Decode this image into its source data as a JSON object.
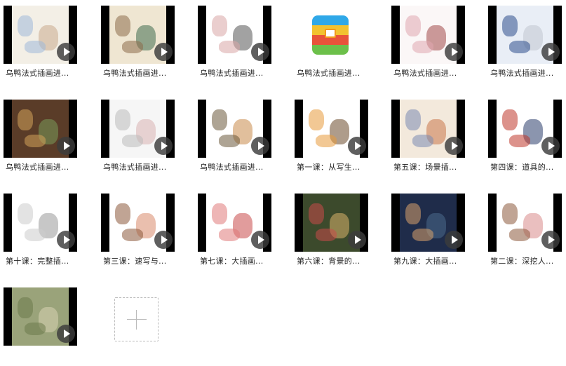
{
  "files": [
    {
      "label": "乌鸭法式插画进...",
      "art": [
        "#f3efe6",
        "#9fb8d8",
        "#c9a98c"
      ],
      "caption": ""
    },
    {
      "label": "乌鸭法式插画进...",
      "art": [
        "#efe6d2",
        "#8c6b4a",
        "#3f6b4e"
      ],
      "caption": ""
    },
    {
      "label": "乌鸭法式插画进...",
      "art": [
        "#ffffff",
        "#d9a6a6",
        "#555555"
      ],
      "caption": ""
    },
    {
      "label": "乌鸭法式插画进...",
      "art": [],
      "caption": "",
      "app_icon": true
    },
    {
      "label": "乌鸭法式插画进...",
      "art": [
        "#fbf7f7",
        "#e0a8b0",
        "#a24a4a"
      ],
      "caption": ""
    },
    {
      "label": "乌鸭法式插画进...",
      "art": [
        "#e9eef6",
        "#2d4f8c",
        "#c1c7d0"
      ],
      "caption": ""
    },
    {
      "label": "乌鸭法式插画进...",
      "art": [
        "#5a3c28",
        "#d4a35a",
        "#7a9a5a"
      ],
      "caption": ""
    },
    {
      "label": "乌鸭法式插画进...",
      "art": [
        "#f6f6f6",
        "#bbbbbb",
        "#d9b3b3"
      ],
      "caption": ""
    },
    {
      "label": "乌鸭法式插画进...",
      "art": [
        "#ffffff",
        "#6b5a3c",
        "#c98a4a"
      ],
      "caption": ""
    },
    {
      "label": "第一课：从写生...",
      "art": [
        "#ffffff",
        "#e79a3c",
        "#6b4a2c"
      ],
      "caption": ""
    },
    {
      "label": "第五课：场景插...",
      "art": [
        "#f3e9dc",
        "#7a8ab3",
        "#c9764a"
      ],
      "caption": ""
    },
    {
      "label": "第四课：道具的...",
      "art": [
        "#ffffff",
        "#c0392b",
        "#2c3e6b"
      ],
      "caption": ""
    },
    {
      "label": "第十课：完整插...",
      "art": [
        "#ffffff",
        "#cccccc",
        "#999999"
      ],
      "caption": ""
    },
    {
      "label": "第三课：速写与...",
      "art": [
        "#ffffff",
        "#8c5a3c",
        "#d98a6b"
      ],
      "caption": ""
    },
    {
      "label": "第七课：大插画...",
      "art": [
        "#ffffff",
        "#e07a7a",
        "#c94a4a"
      ],
      "caption": ""
    },
    {
      "label": "第六课：背景的...",
      "art": [
        "#3c4a2c",
        "#c94a4a",
        "#d9b36b"
      ],
      "caption": ""
    },
    {
      "label": "第九课：大插画...",
      "art": [
        "#1f2c4a",
        "#d9a36b",
        "#4a6b8c"
      ],
      "caption": ""
    },
    {
      "label": "第二课：深挖人...",
      "art": [
        "#ffffff",
        "#8c5a3c",
        "#d98a8a"
      ],
      "caption": ""
    },
    {
      "label": "",
      "art": [
        "#9aa37a",
        "#6b7a4a",
        "#d9d3b3"
      ],
      "caption": ""
    }
  ],
  "add_button": {
    "label": "+"
  }
}
